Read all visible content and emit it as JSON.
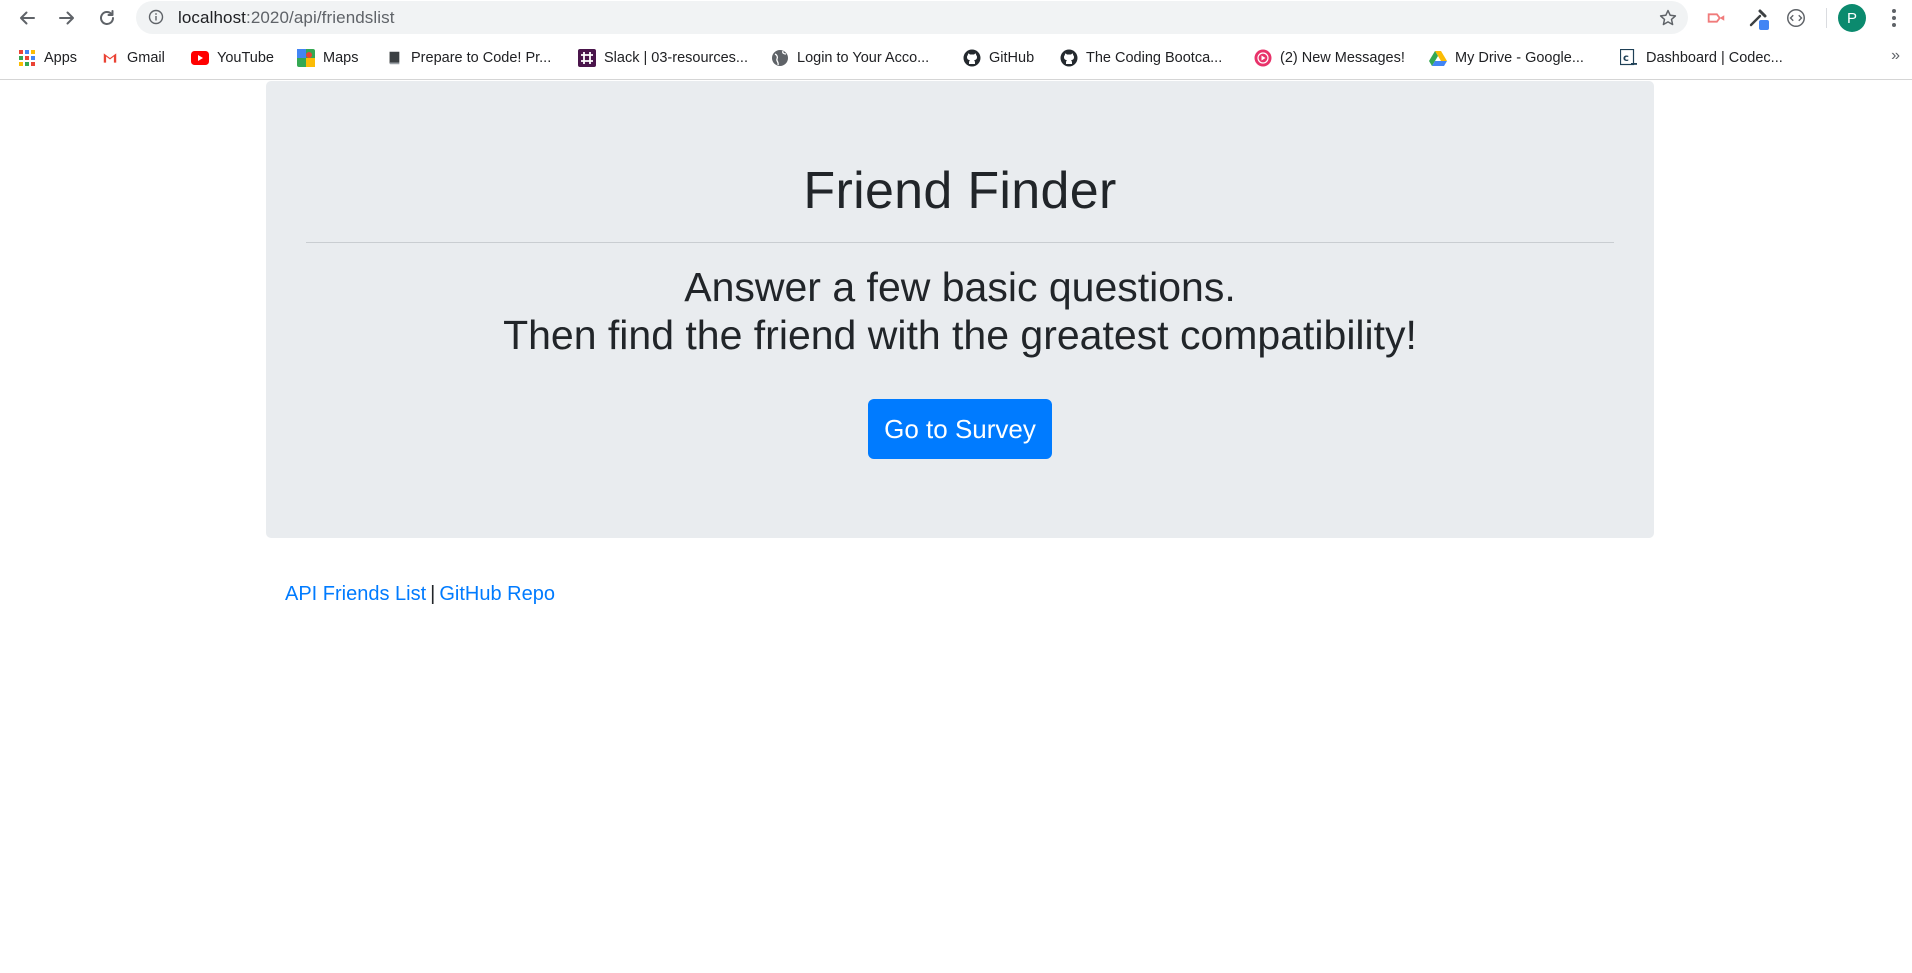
{
  "browser": {
    "url_host": "localhost",
    "url_rest": ":2020/api/friendslist",
    "avatar_letter": "P"
  },
  "bookmarks": [
    {
      "label": "Apps",
      "icon": "apps-grid-icon"
    },
    {
      "label": "Gmail",
      "icon": "gmail-icon"
    },
    {
      "label": "YouTube",
      "icon": "youtube-icon"
    },
    {
      "label": "Maps",
      "icon": "maps-icon"
    },
    {
      "label": "Prepare to Code! Pr...",
      "icon": "book-icon"
    },
    {
      "label": "Slack | 03-resources...",
      "icon": "slack-icon"
    },
    {
      "label": "Login to Your Acco...",
      "icon": "globe-icon"
    },
    {
      "label": "GitHub",
      "icon": "github-icon"
    },
    {
      "label": "The Coding Bootca...",
      "icon": "github-icon"
    },
    {
      "label": "(2) New Messages!",
      "icon": "messages-icon"
    },
    {
      "label": "My Drive - Google...",
      "icon": "drive-icon"
    },
    {
      "label": "Dashboard | Codec...",
      "icon": "codecademy-icon"
    }
  ],
  "page": {
    "title": "Friend Finder",
    "lead_line1": "Answer a few basic questions.",
    "lead_line2": "Then find the friend with the greatest compatibility!",
    "survey_button": "Go to Survey",
    "footer": {
      "api_link": "API Friends List",
      "separator": "|",
      "github_link": "GitHub Repo"
    }
  },
  "colors": {
    "jumbotron_bg": "#e9ecef",
    "primary": "#007bff",
    "text": "#212529"
  }
}
